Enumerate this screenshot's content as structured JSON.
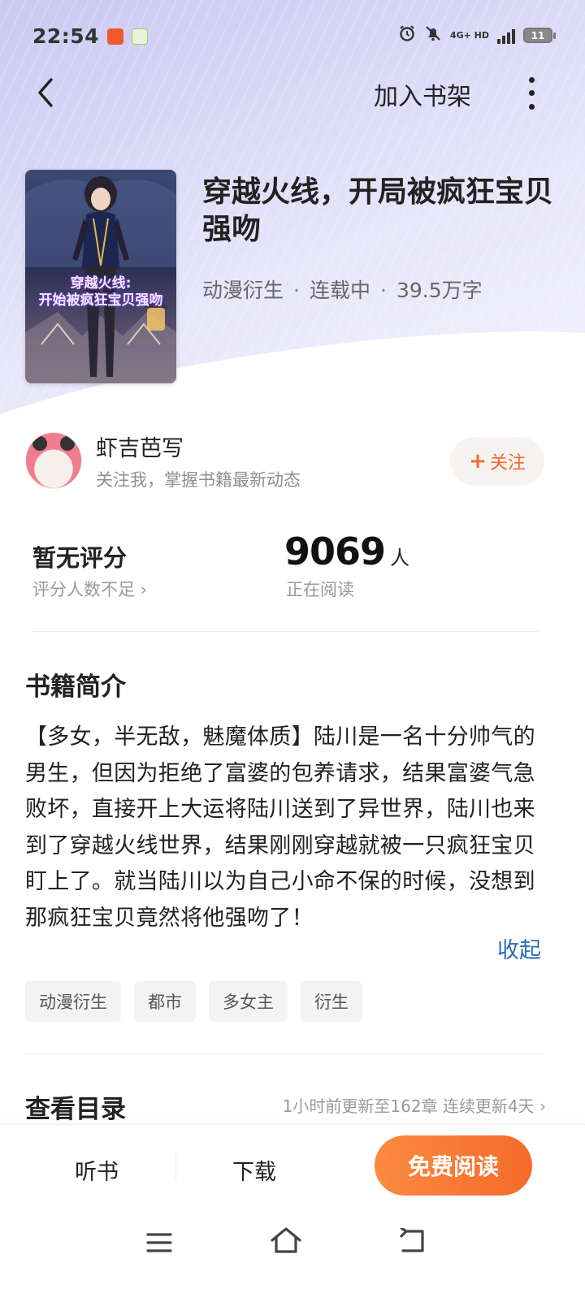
{
  "status_bar": {
    "time": "22:54",
    "network": "4G+ HD",
    "battery": "11",
    "icons": [
      "alarm-icon",
      "mute-bell-icon",
      "signal-icon",
      "battery-icon"
    ]
  },
  "nav": {
    "add_to_shelf": "加入书架",
    "back_icon": "chevron-left-icon",
    "more_icon": "more-vertical-icon"
  },
  "book": {
    "title": "穿越火线，开局被疯狂宝贝强吻",
    "cover_text": "穿越火线:\n开始被疯狂宝贝强吻",
    "category": "动漫衍生",
    "status": "连载中",
    "word_count": "39.5万字"
  },
  "author": {
    "name": "虾吉芭写",
    "desc": "关注我，掌握书籍最新动态",
    "follow_label": "关注",
    "follow_plus": "+"
  },
  "stats": {
    "rating": "暂无评分",
    "rating_note": "评分人数不足 ›",
    "readers": "9069",
    "readers_unit": "人",
    "readers_label": "正在阅读"
  },
  "intro": {
    "heading": "书籍简介",
    "text": "【多女，半无敌，魅魔体质】陆川是一名十分帅气的男生，但因为拒绝了富婆的包养请求，结果富婆气急败坏，直接开上大运将陆川送到了异世界，陆川也来到了穿越火线世界，结果刚刚穿越就被一只疯狂宝贝盯上了。就当陆川以为自己小命不保的时候，没想到那疯狂宝贝竟然将他强吻了！",
    "collapse": "收起"
  },
  "tags": [
    "动漫衍生",
    "都市",
    "多女主",
    "衍生"
  ],
  "catalog": {
    "heading": "查看目录",
    "info": "1小时前更新至162章 连续更新4天 ›"
  },
  "actions": {
    "listen": "听书",
    "download": "下载",
    "read_free": "免费阅读"
  },
  "colors": {
    "accent": "#f56b2a",
    "link": "#2a6bb8",
    "hero": "#d9d8f6"
  }
}
